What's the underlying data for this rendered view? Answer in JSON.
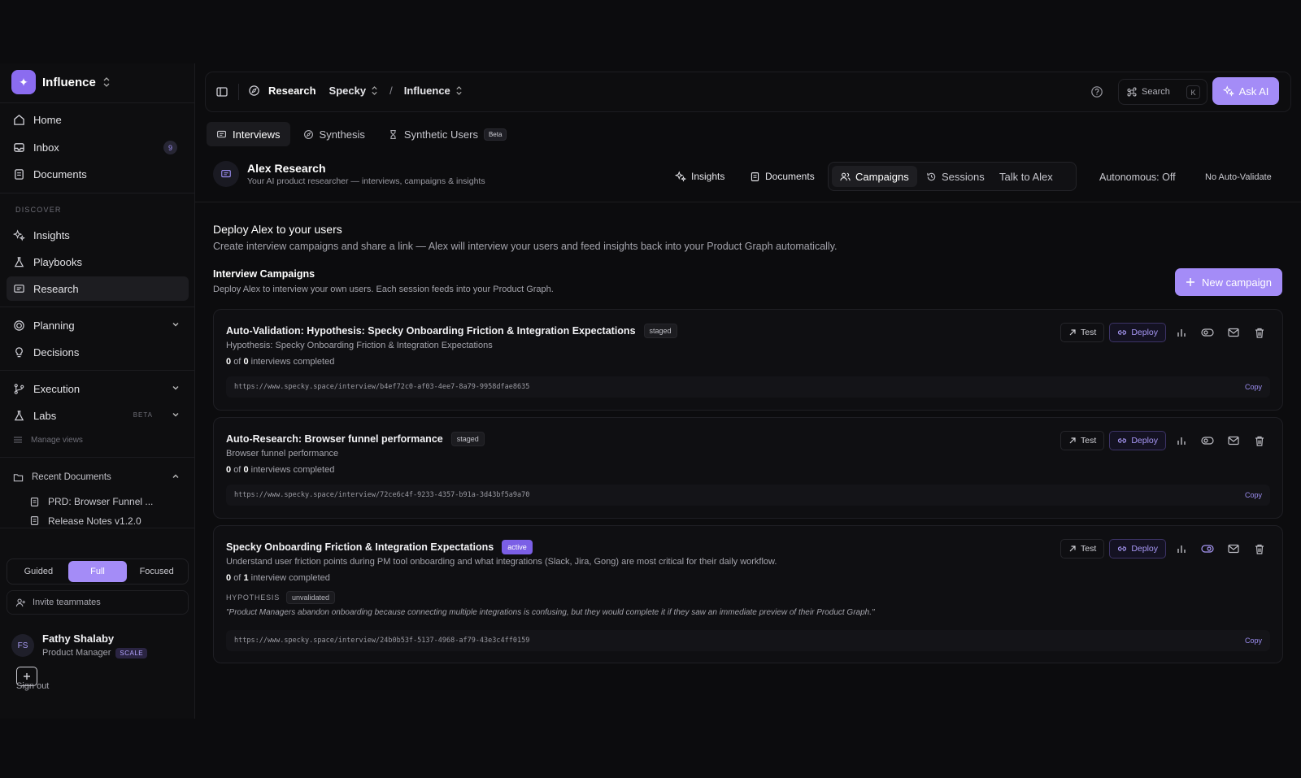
{
  "workspace": {
    "name": "Influence"
  },
  "sidebar": {
    "items": [
      {
        "label": "Home"
      },
      {
        "label": "Inbox",
        "count": "9"
      },
      {
        "label": "Documents"
      }
    ],
    "discover_label": "DISCOVER",
    "discover": [
      {
        "label": "Insights"
      },
      {
        "label": "Playbooks"
      },
      {
        "label": "Research"
      }
    ],
    "planning": {
      "label": "Planning"
    },
    "decisions": {
      "label": "Decisions"
    },
    "execution": {
      "label": "Execution"
    },
    "labs": {
      "label": "Labs",
      "tag": "BETA"
    },
    "manage_views": "Manage views",
    "recent_docs_label": "Recent Documents",
    "recent_docs": [
      "PRD: Browser Funnel ...",
      "Release Notes v1.2.0"
    ],
    "modes": [
      "Guided",
      "Full",
      "Focused"
    ],
    "invite": "Invite teammates",
    "user": {
      "initials": "FS",
      "name": "Fathy Shalaby",
      "role": "Product Manager",
      "plan": "SCALE"
    },
    "sign_out": "Sign out"
  },
  "topbar": {
    "crumb_root": "Research",
    "crumb_project": "Specky",
    "crumb_sep": "/",
    "crumb_ws": "Influence",
    "search_label": "Search",
    "search_kbd": "K",
    "ask_ai": "Ask AI"
  },
  "tabs": [
    {
      "label": "Interviews"
    },
    {
      "label": "Synthesis"
    },
    {
      "label": "Synthetic Users",
      "badge": "Beta"
    }
  ],
  "agent": {
    "name": "Alex Research",
    "subtitle": "Your AI product researcher — interviews, campaigns & insights",
    "nav_insights": "Insights",
    "nav_documents": "Documents",
    "seg": [
      "Campaigns",
      "Sessions",
      "Talk to Alex"
    ],
    "autonomous": "Autonomous: Off",
    "auto_validate": "No Auto-Validate"
  },
  "deploy": {
    "title": "Deploy Alex to your users",
    "subtitle": "Create interview campaigns and share a link — Alex will interview your users and feed insights back into your Product Graph automatically."
  },
  "campaigns_section": {
    "title": "Interview Campaigns",
    "subtitle": "Deploy Alex to interview your own users. Each session feeds into your Product Graph.",
    "new_button": "New campaign"
  },
  "actions": {
    "test": "Test",
    "deploy": "Deploy",
    "copy": "Copy"
  },
  "campaigns": [
    {
      "title": "Auto-Validation: Hypothesis: Specky Onboarding Friction & Integration Expectations",
      "status": "staged",
      "desc": "Hypothesis: Specky Onboarding Friction & Integration Expectations",
      "done": "0",
      "of": "of",
      "total": "0",
      "prog_suffix": "interviews completed",
      "url": "https://www.specky.space/interview/b4ef72c0-af03-4ee7-8a79-9958dfae8635"
    },
    {
      "title": "Auto-Research: Browser funnel performance",
      "status": "staged",
      "desc": "Browser funnel performance",
      "done": "0",
      "of": "of",
      "total": "0",
      "prog_suffix": "interviews completed",
      "url": "https://www.specky.space/interview/72ce6c4f-9233-4357-b91a-3d43bf5a9a70"
    },
    {
      "title": "Specky Onboarding Friction & Integration Expectations",
      "status": "active",
      "desc": "Understand user friction points during PM tool onboarding and what integrations (Slack, Jira, Gong) are most critical for their daily workflow.",
      "done": "0",
      "of": "of",
      "total": "1",
      "prog_suffix": "interview completed",
      "hypothesis_label": "HYPOTHESIS",
      "hypothesis_status": "unvalidated",
      "hypothesis": "\"Product Managers abandon onboarding because connecting multiple integrations is confusing, but they would complete it if they saw an immediate preview of their Product Graph.\"",
      "url": "https://www.specky.space/interview/24b0b53f-5137-4968-af79-43e3c4ff0159"
    }
  ],
  "colors": {
    "accent": "#a48cf7",
    "background": "#0c0c0e",
    "panel": "#0f0f12"
  }
}
